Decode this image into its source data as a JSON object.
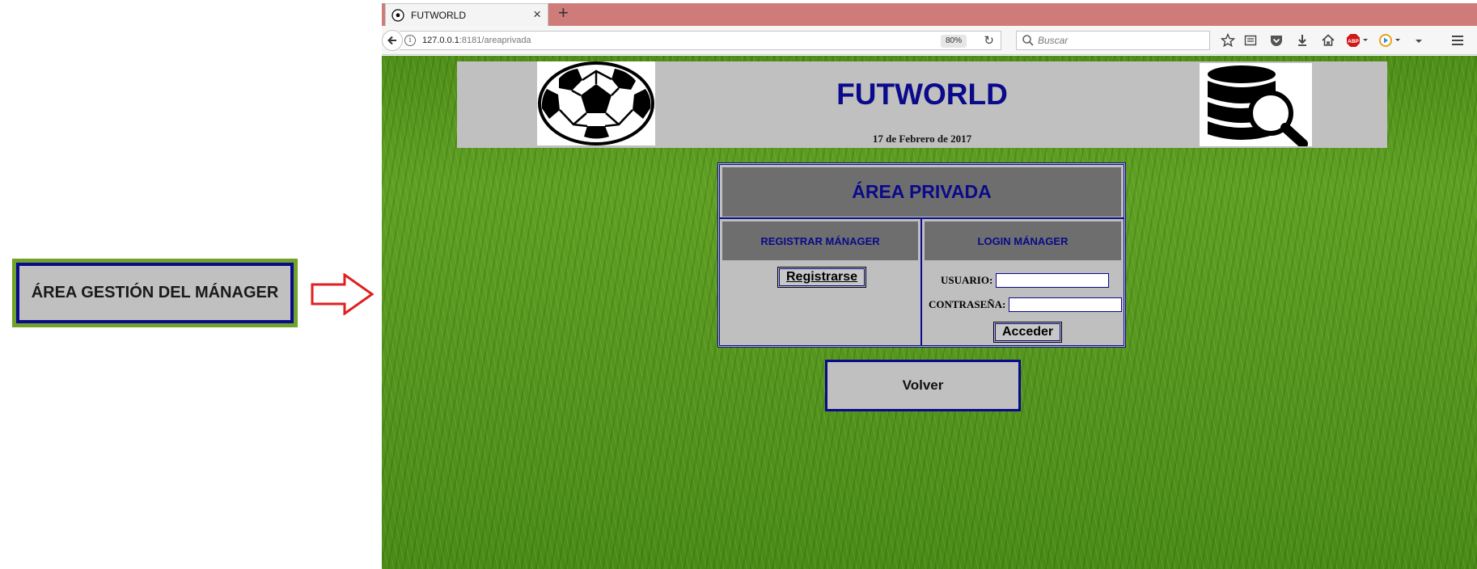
{
  "annotation": {
    "label": "ÁREA GESTIÓN DEL MÁNAGER",
    "box_color": "#6fa32a",
    "arrow_color": "#e02020"
  },
  "browser": {
    "tab": {
      "title": "FUTWORLD",
      "favicon": "soccer-ball-icon",
      "close": "×"
    },
    "new_tab": "+",
    "url": {
      "host": "127.0.0.1",
      "rest": ":8181/areaprivada"
    },
    "zoom": "80%",
    "search_placeholder": "Buscar",
    "toolbar_icons": [
      "star-icon",
      "reader-list-icon",
      "pocket-icon",
      "download-icon",
      "home-icon",
      "adblock-icon",
      "extension-icon",
      "menu-icon"
    ],
    "adblock_label": "ABP"
  },
  "page": {
    "title": "FUTWORLD",
    "date": "17 de Febrero de 2017",
    "panel": {
      "heading": "ÁREA PRIVADA",
      "register": {
        "heading": "REGISTRAR MÁNAGER",
        "button": "Registrarse"
      },
      "login": {
        "heading": "LOGIN MÁNAGER",
        "user_label": "USUARIO:",
        "user_value": "",
        "password_label": "CONTRASEÑA:",
        "password_value": "",
        "button": "Acceder"
      }
    },
    "back_button": "Volver"
  },
  "colors": {
    "title_blue": "#0a0a8a",
    "panel_gray": "#bfbfbf",
    "header_gray": "#6e6e6e",
    "grass_green": "#56961f"
  }
}
